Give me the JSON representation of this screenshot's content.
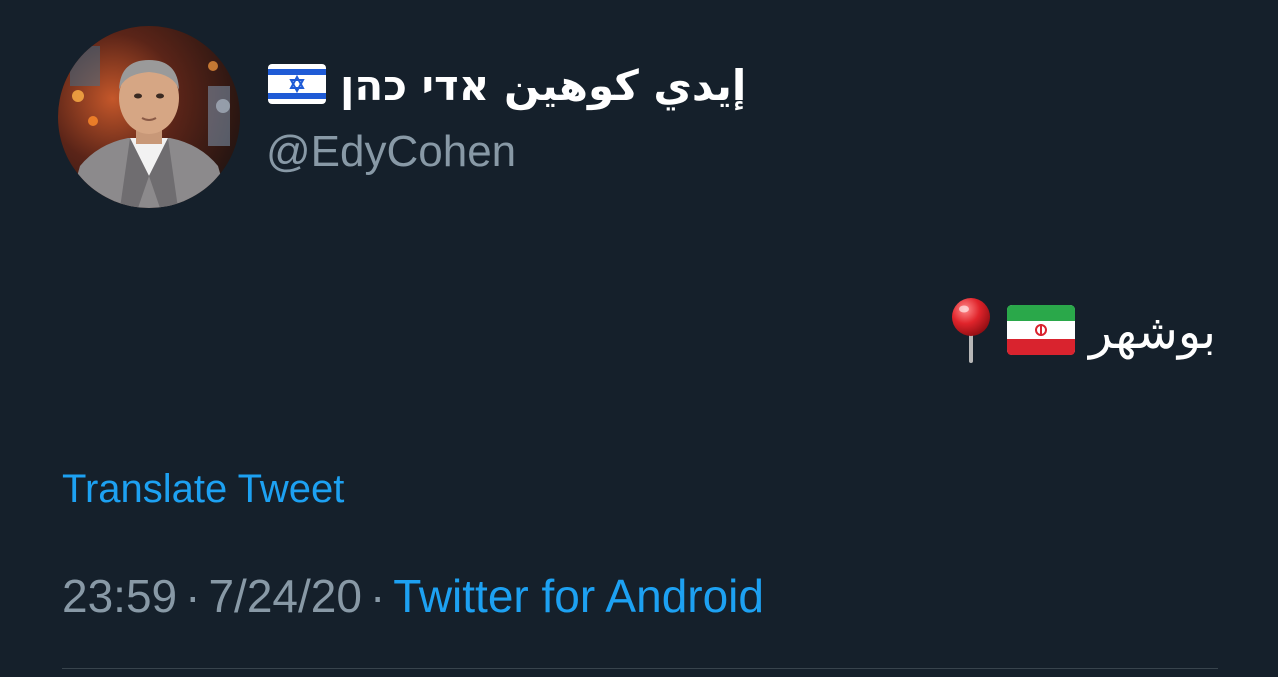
{
  "author": {
    "display_name": "إيدي كوهين אדי כהן",
    "handle": "@EdyCohen",
    "name_emoji": "israel-flag"
  },
  "tweet": {
    "text": "بوشهر",
    "emojis": [
      "iran-flag",
      "round-pushpin"
    ]
  },
  "translate_label": "Translate Tweet",
  "meta": {
    "time": "23:59",
    "separator": "·",
    "date": "7/24/20",
    "source": "Twitter for Android"
  },
  "colors": {
    "background": "#15202b",
    "secondary_text": "#8899a6",
    "link": "#1da1f2",
    "divider": "#38444d"
  }
}
